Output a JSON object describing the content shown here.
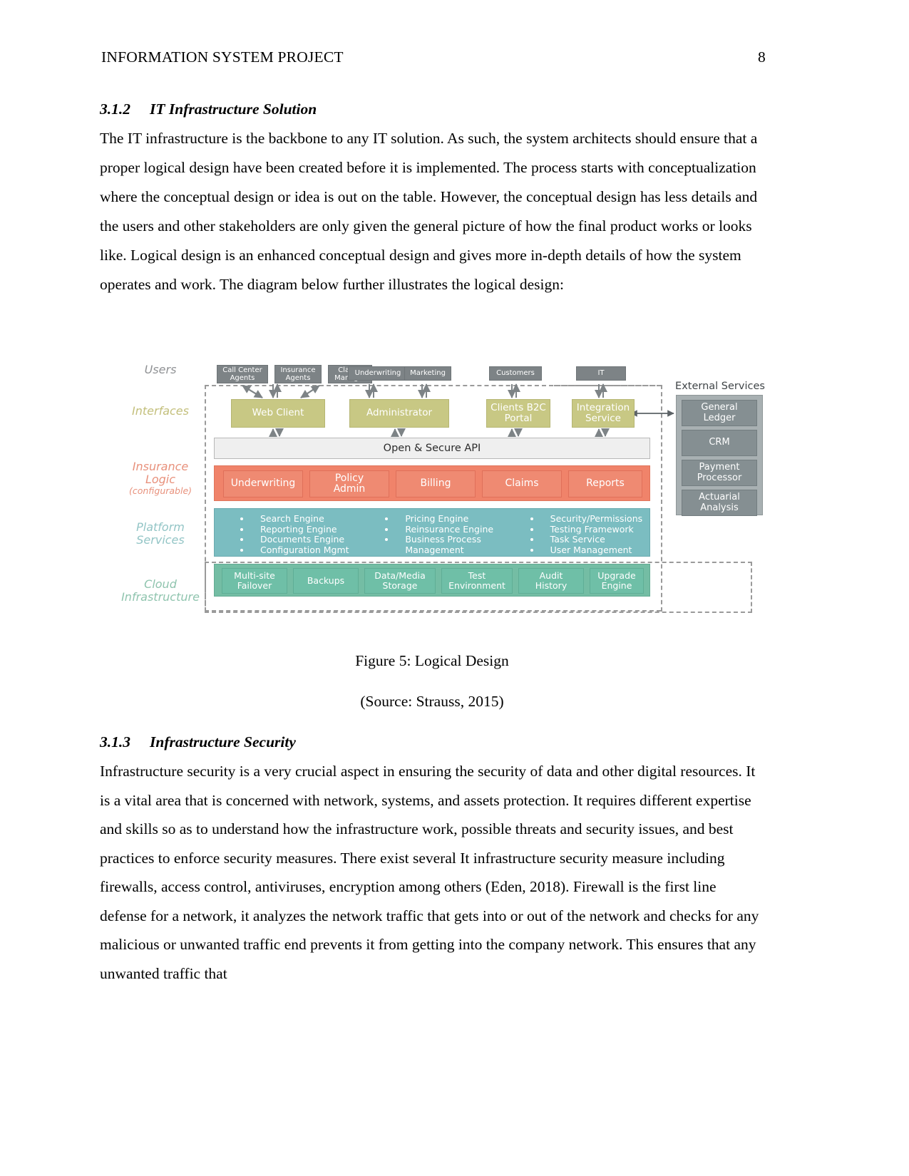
{
  "header": {
    "title": "INFORMATION SYSTEM PROJECT",
    "page_number": "8"
  },
  "sections": [
    {
      "number": "3.1.2",
      "title": "IT Infrastructure Solution",
      "body": "The IT infrastructure is the backbone to any IT solution. As such, the system architects should ensure that a proper logical design have been created before it is implemented. The process starts with conceptualization where the conceptual design or idea is out on the table. However, the conceptual design has less details and the users and other stakeholders are only given the general picture of how the final product works or looks like. Logical design is an enhanced conceptual design and gives more in-depth details of how the system operates and work. The diagram below further illustrates the logical design:"
    },
    {
      "number": "3.1.3",
      "title": "Infrastructure Security",
      "body": "Infrastructure security is a very crucial aspect in ensuring the security of data and other digital resources. It is a vital area that is concerned with network, systems, and assets protection. It requires different expertise and skills so as to understand how the infrastructure work, possible threats and security issues, and best practices to enforce security measures. There exist several It infrastructure security measure including firewalls, access control, antiviruses, encryption among others (Eden, 2018). Firewall is the first line defense for a network, it analyzes the network traffic that gets into or out of the network and checks for any malicious or unwanted traffic end prevents it from getting into the company network. This ensures that any unwanted traffic that"
    }
  ],
  "figure": {
    "caption": "Figure 5: Logical Design",
    "source": "(Source: Strauss, 2015)",
    "row_labels": {
      "users": "Users",
      "interfaces": "Interfaces",
      "logic": "Insurance Logic",
      "logic_line1": "Insurance",
      "logic_line2": "Logic",
      "logic_sub": "(configurable)",
      "platform_line1": "Platform",
      "platform_line2": "Services",
      "cloud_line1": "Cloud",
      "cloud_line2": "Infrastructure"
    },
    "users": [
      {
        "line1": "Call Center",
        "line2": "Agents"
      },
      {
        "line1": "Insurance",
        "line2": "Agents"
      },
      {
        "line1": "Claims",
        "line2": "Manager"
      },
      {
        "line1": "Underwriting",
        "line2": ""
      },
      {
        "line1": "Marketing",
        "line2": ""
      },
      {
        "line1": "Customers",
        "line2": ""
      },
      {
        "line1": "IT",
        "line2": ""
      }
    ],
    "interfaces": [
      {
        "line1": "Web Client",
        "line2": ""
      },
      {
        "line1": "Administrator",
        "line2": ""
      },
      {
        "line1": "Clients B2C",
        "line2": "Portal"
      },
      {
        "line1": "Integration",
        "line2": "Service"
      }
    ],
    "api_bar": "Open & Secure API",
    "logic_modules": [
      {
        "line1": "Underwriting",
        "line2": ""
      },
      {
        "line1": "Policy",
        "line2": "Admin"
      },
      {
        "line1": "Billing",
        "line2": ""
      },
      {
        "line1": "Claims",
        "line2": ""
      },
      {
        "line1": "Reports",
        "line2": ""
      }
    ],
    "platform_services": {
      "column1": [
        "Search Engine",
        "Reporting Engine",
        "Documents Engine",
        "Configuration Mgmt"
      ],
      "column2": [
        "Pricing Engine",
        "Reinsurance Engine",
        "Business Process",
        "Management"
      ],
      "column2_nobullet_index": 3,
      "column3": [
        "Security/Permissions",
        "Testing Framework",
        "Task Service",
        "User Management"
      ]
    },
    "cloud_services": [
      {
        "line1": "Multi-site",
        "line2": "Failover"
      },
      {
        "line1": "Backups",
        "line2": ""
      },
      {
        "line1": "Data/Media",
        "line2": "Storage"
      },
      {
        "line1": "Test",
        "line2": "Environment"
      },
      {
        "line1": "Audit",
        "line2": "History"
      },
      {
        "line1": "Upgrade",
        "line2": "Engine"
      }
    ],
    "external": {
      "title": "External Services",
      "items": [
        {
          "line1": "General",
          "line2": "Ledger"
        },
        {
          "line1": "CRM",
          "line2": ""
        },
        {
          "line1": "Payment",
          "line2": "Processor"
        },
        {
          "line1": "Actuarial",
          "line2": "Analysis"
        }
      ]
    },
    "colors": {
      "users_box": "#7d8386",
      "interface_box": "#c8c884",
      "api_bar": "#efefef",
      "logic_band": "#f0836a",
      "platform_band": "#7bbdc1",
      "cloud_band": "#74bda4",
      "external_panel": "#a8b0b2",
      "arrow": "#7d8386",
      "dashed_border": "#9a9a9a"
    }
  }
}
